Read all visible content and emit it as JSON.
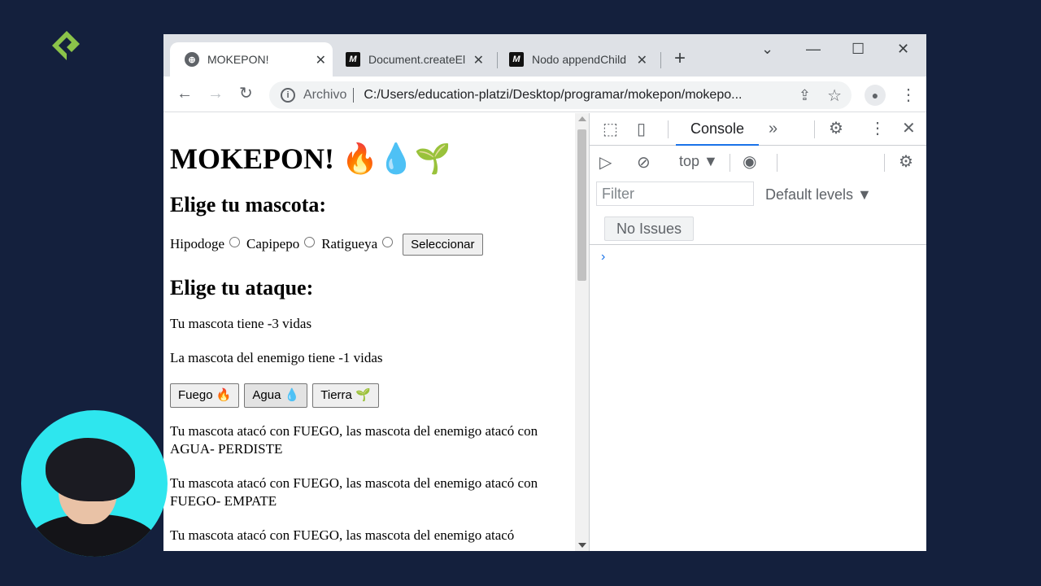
{
  "tabs": [
    {
      "title": "MOKEPON!",
      "favicon": "globe-icon",
      "active": true
    },
    {
      "title": "Document.createEl",
      "favicon": "mdn-icon",
      "active": false
    },
    {
      "title": "Nodo appendChild",
      "favicon": "mdn-icon",
      "active": false
    }
  ],
  "favicon_glyph": "M",
  "address": {
    "scheme": "Archivo",
    "url": "C:/Users/education-platzi/Desktop/programar/mokepon/mokepo..."
  },
  "page": {
    "title": "MOKEPON! 🔥💧🌱",
    "pet_heading": "Elige tu mascota:",
    "pets": [
      "Hipodoge",
      "Capipepo",
      "Ratigueya"
    ],
    "select_button": "Seleccionar",
    "attack_heading": "Elige tu ataque:",
    "player_lives": "Tu mascota tiene -3 vidas",
    "enemy_lives": "La mascota del enemigo tiene -1 vidas",
    "attack_buttons": [
      "Fuego 🔥",
      "Agua 💧",
      "Tierra 🌱"
    ],
    "messages": [
      "Tu mascota atacó con FUEGO, las mascota del enemigo atacó con AGUA- PERDISTE",
      "Tu mascota atacó con FUEGO, las mascota del enemigo atacó con FUEGO- EMPATE",
      "Tu mascota atacó con FUEGO, las mascota del enemigo atacó"
    ]
  },
  "devtools": {
    "tab": "Console",
    "context": "top ▼",
    "filter_placeholder": "Filter",
    "levels": "Default levels ▼",
    "issues": "No Issues",
    "prompt": "›"
  },
  "colors": {
    "background": "#14203d",
    "webcam": "#2ee6ee",
    "logo": "#8bc34a",
    "accent": "#1a73e8"
  }
}
